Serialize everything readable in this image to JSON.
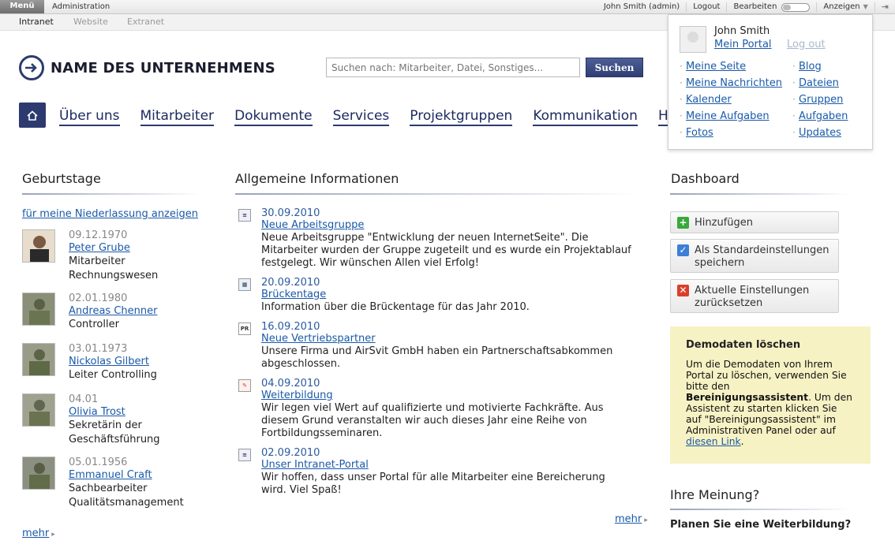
{
  "topbar": {
    "menu_label": "Menü",
    "admin_label": "Administration",
    "user_label": "John Smith (admin)",
    "logout_label": "Logout",
    "edit_label": "Bearbeiten",
    "view_label": "Anzeigen"
  },
  "subbar": {
    "tabs": [
      "Intranet",
      "Website",
      "Extranet"
    ]
  },
  "header": {
    "company_name": "NAME DES UNTERNEHMENS",
    "search_placeholder": "Suchen nach: Mitarbeiter, Datei, Sonstiges...",
    "search_button": "Suchen"
  },
  "nav": {
    "items": [
      "Über uns",
      "Mitarbeiter",
      "Dokumente",
      "Services",
      "Projektgruppen",
      "Kommunikation",
      "Hilfe"
    ]
  },
  "user_panel": {
    "name": "John Smith",
    "my_portal": "Mein Portal",
    "logout": "Log out",
    "col1": [
      "Meine Seite",
      "Meine Nachrichten",
      "Kalender",
      "Meine Aufgaben",
      "Fotos"
    ],
    "col2": [
      "Blog",
      "Dateien",
      "Gruppen",
      "Aufgaben",
      "Updates"
    ]
  },
  "birthdays": {
    "title": "Geburtstage",
    "filter_link": "für meine Niederlassung anzeigen",
    "people": [
      {
        "date": "09.12.1970",
        "name": "Peter Grube",
        "role": "Mitarbeiter Rechnungswesen"
      },
      {
        "date": "02.01.1980",
        "name": "Andreas Chenner",
        "role": "Controller"
      },
      {
        "date": "03.01.1973",
        "name": "Nickolas Gilbert",
        "role": "Leiter Controlling"
      },
      {
        "date": "04.01",
        "name": "Olivia Trost",
        "role": "Sekretärin der Geschäftsführung"
      },
      {
        "date": "05.01.1956",
        "name": "Emmanuel Craft",
        "role": "Sachbearbeiter Qualitätsmanagement"
      }
    ],
    "more": "mehr"
  },
  "news": {
    "title": "Allgemeine Informationen",
    "items": [
      {
        "date": "30.09.2010",
        "title": "Neue Arbeitsgruppe",
        "text": "Neue Arbeitsgruppe \"Entwicklung der neuen InternetSeite\". Die Mitarbeiter wurden der Gruppe zugeteilt und es wurde ein Projektablauf festgelegt. Wir wünschen Allen viel Erfolg!",
        "icon": "document-icon"
      },
      {
        "date": "20.09.2010",
        "title": "Brückentage",
        "text": "Information über die Brückentage für das Jahr 2010.",
        "icon": "calendar-icon"
      },
      {
        "date": "16.09.2010",
        "title": "Neue Vertriebspartner",
        "text": "Unsere Firma und AirSvit GmbH haben ein Partnerschaftsabkommen abgeschlossen.",
        "icon": "pr-icon",
        "icon_text": "PR"
      },
      {
        "date": "04.09.2010",
        "title": "Weiterbildung",
        "text": "Wir legen viel Wert auf qualifizierte und motivierte Fachkräfte. Aus diesem Grund veranstalten wir auch dieses Jahr eine Reihe von Fortbildungsseminaren.",
        "icon": "certificate-icon"
      },
      {
        "date": "02.09.2010",
        "title": "Unser Intranet-Portal",
        "text": "Wir hoffen, dass unser Portal für alle Mitarbeiter eine Bereicherung wird. Viel Spaß!",
        "icon": "document-icon"
      }
    ],
    "more": "mehr"
  },
  "dashboard": {
    "title": "Dashboard",
    "add": "Hinzufügen",
    "save_defaults": "Als Standardeinstellungen speichern",
    "reset": "Aktuelle Einstellungen zurücksetzen",
    "colors": {
      "add": "#3aa83a",
      "save": "#3c7fd6",
      "reset": "#d9402a"
    }
  },
  "demo": {
    "title": "Demodaten löschen",
    "text_1": "Um die Demodaten von Ihrem Portal zu löschen, verwenden Sie bitte den ",
    "bold": "Bereinigungsassistent",
    "text_2": ". Um den Assistent zu starten klicken Sie auf \"Bereinigungsassistent\" im Administrativen Panel oder auf ",
    "link": "diesen Link",
    "text_3": "."
  },
  "opinion": {
    "title": "Ihre Meinung?",
    "question": "Planen Sie eine Weiterbildung?"
  },
  "colors": {
    "brand": "#2d3a70",
    "link": "#1a5aa8",
    "demo_bg": "#f7f2c4"
  }
}
